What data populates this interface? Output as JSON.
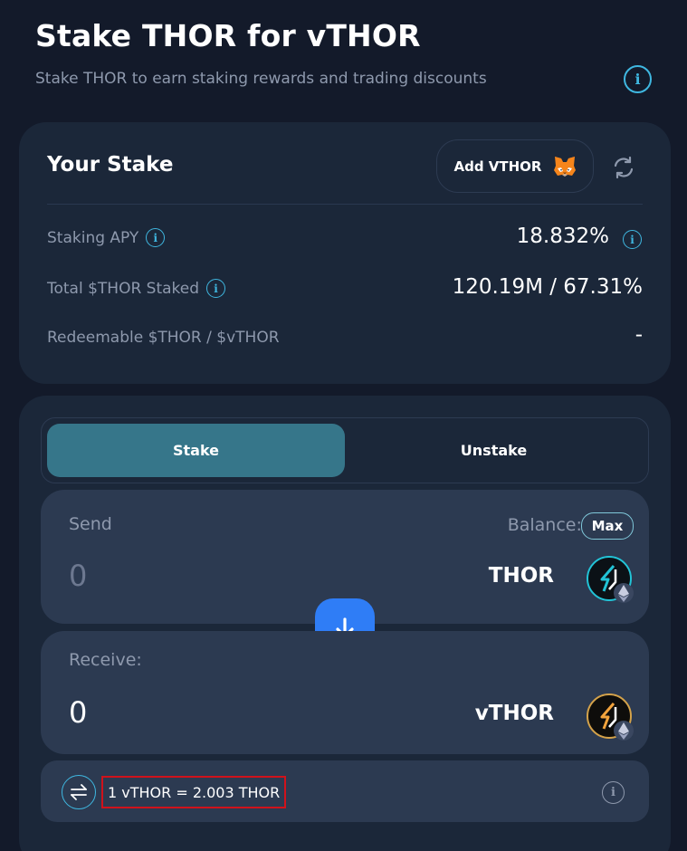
{
  "header": {
    "title": "Stake THOR for vTHOR",
    "subtitle": "Stake THOR to earn staking rewards and trading discounts"
  },
  "stake_card": {
    "title": "Your Stake",
    "add_vthor_label": "Add VTHOR",
    "stats": [
      {
        "label": "Staking APY",
        "value": "18.832%"
      },
      {
        "label": "Total $THOR Staked",
        "value": "120.19M / 67.31%"
      },
      {
        "label": "Redeemable $THOR / $vTHOR",
        "value": "-"
      }
    ]
  },
  "swap": {
    "tabs": [
      {
        "label": "Stake",
        "active": true
      },
      {
        "label": "Unstake",
        "active": false
      }
    ],
    "send": {
      "label": "Send",
      "balance_label": "Balance: 0",
      "max_label": "Max",
      "amount": "0",
      "token": "THOR"
    },
    "receive": {
      "label": "Receive:",
      "amount": "0",
      "token": "vTHOR"
    },
    "rate": "1 vTHOR = 2.003 THOR"
  },
  "icons": {
    "info": "info-icon",
    "metamask": "metamask-fox-icon",
    "refresh": "refresh-icon",
    "arrow_down": "arrow-down-icon",
    "swap_toggle": "swap-direction-icon"
  },
  "colors": {
    "background": "#131a2a",
    "card": "#1b2739",
    "panel": "#2c3a51",
    "accent_tab": "#36768a",
    "accent_blue": "#2f7df6",
    "info_cyan": "#3fb7e0",
    "highlight_red": "#d0121b"
  }
}
